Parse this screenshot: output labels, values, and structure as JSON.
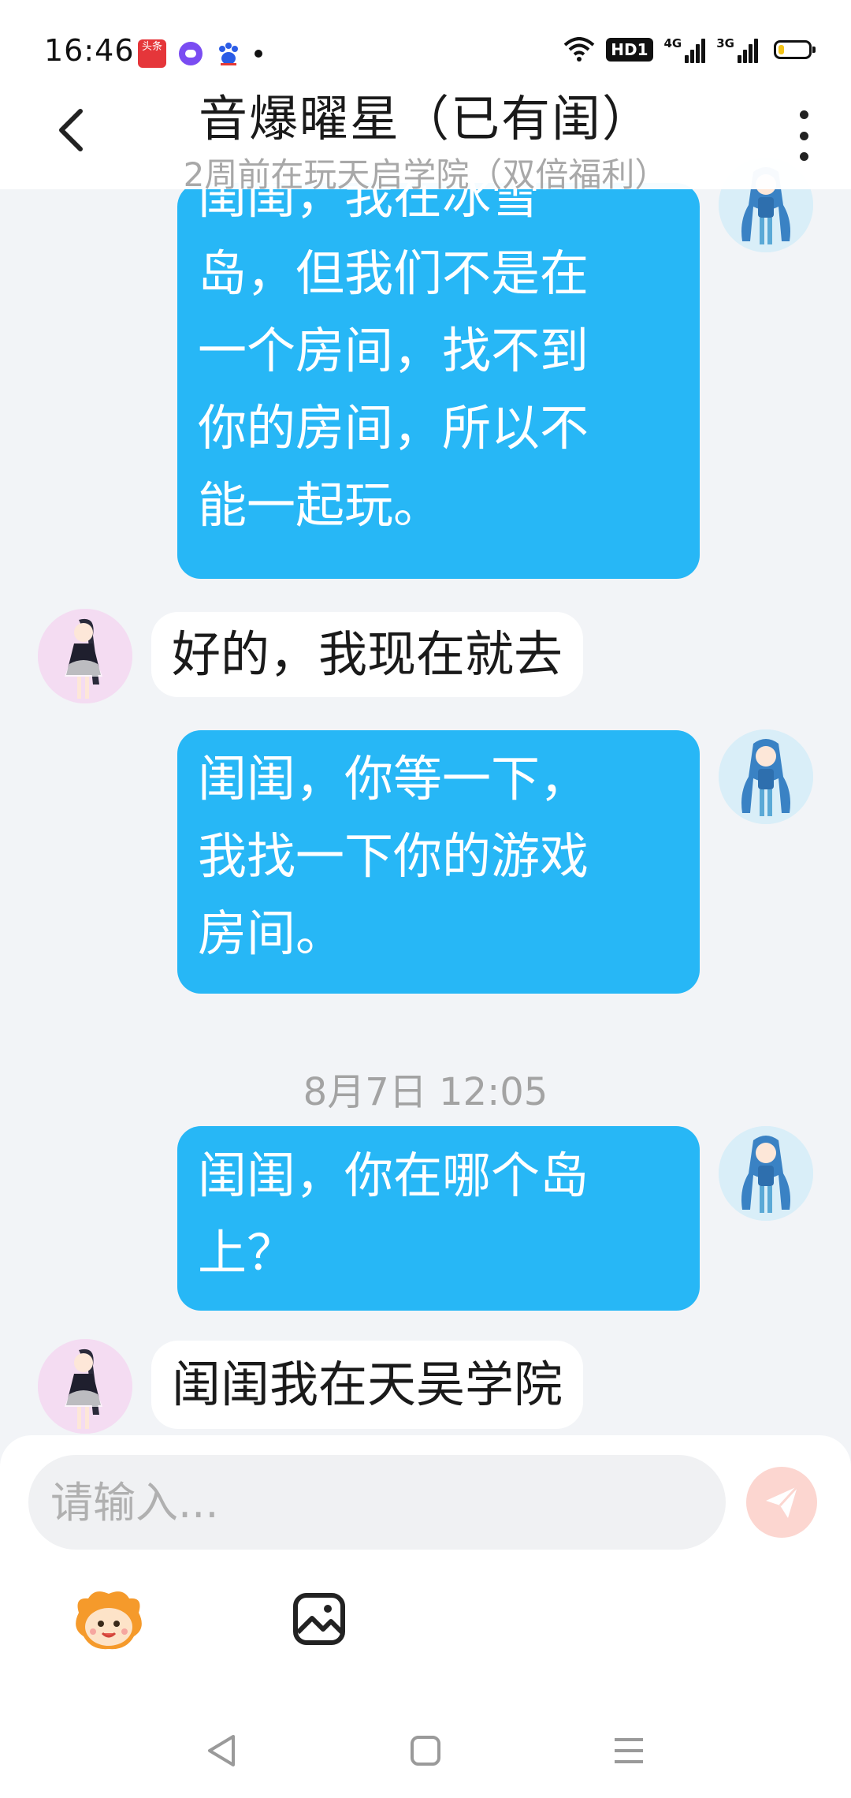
{
  "status_bar": {
    "time": "16:46",
    "app_icons": [
      "toutiao-app-icon",
      "purple-chat-app-icon",
      "baidu-app-icon"
    ],
    "toutiao_label": "头条",
    "signal_1_label": "4G",
    "signal_2_label": "3G",
    "hd_label": "HD1",
    "battery_level": 0.2,
    "colors": {
      "battery_fill": "#f3c316"
    }
  },
  "header": {
    "title": "音爆曜星（已有闺）",
    "subtitle": "2周前在玩天启学院（双倍福利）"
  },
  "messages": [
    {
      "sender": "me",
      "text_lines": [
        "闺闺，我在冰雪",
        "岛，但我们不是在",
        "一个房间，找不到",
        "你的房间，所以不",
        "能一起玩。"
      ]
    },
    {
      "sender": "other",
      "text": "好的，我现在就去"
    },
    {
      "sender": "me",
      "text_lines": [
        "闺闺，你等一下，",
        "我找一下你的游戏",
        "房间。"
      ]
    },
    {
      "sender": "me",
      "text_lines": [
        "闺闺，你在哪个岛",
        "上？"
      ]
    },
    {
      "sender": "other",
      "text": "闺闺我在天吴学院"
    }
  ],
  "timestamp": "8月7日 12:05",
  "input": {
    "placeholder": "请输入..."
  },
  "toolbar": {
    "emoji_icon": "emoji-mascot-icon",
    "image_icon": "image-icon",
    "send_icon": "send-icon"
  },
  "colors": {
    "outgoing_bubble": "#27b7f6",
    "incoming_bubble": "#ffffff",
    "background": "#f2f4f7",
    "send_button": "#fcd6d0"
  }
}
